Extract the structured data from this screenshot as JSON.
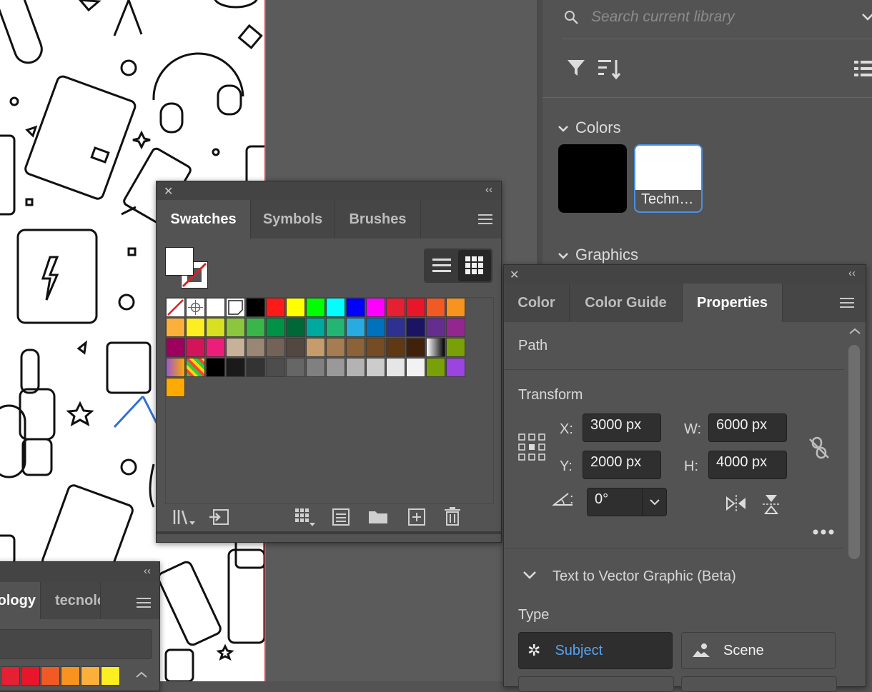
{
  "libraries": {
    "search_placeholder": "Search current library",
    "colors_header": "Colors",
    "graphics_header": "Graphics",
    "color_tiles": [
      {
        "label": "",
        "color": "#000000"
      },
      {
        "label": "Techn…",
        "color": "#ffffff"
      }
    ]
  },
  "swatches_panel": {
    "tabs": [
      "Swatches",
      "Symbols",
      "Brushes"
    ],
    "active_tab": "Swatches",
    "rows": [
      [
        "none",
        "registration",
        "#ffffff",
        "#ffffff",
        "#000000",
        "#ff1a1a",
        "#ffff00",
        "#00ff00",
        "#00ffff",
        "#0000ff",
        "#ff00ff",
        "#e42032",
        "#e8162b",
        "#f15a24",
        "#f7931e"
      ],
      [
        "#fbb03b",
        "#fcee21",
        "#d9e021",
        "#8cc63f",
        "#39b54a",
        "#009245",
        "#006837",
        "#00a99d",
        "#22b573",
        "#29abe2",
        "#0071bc",
        "#2e3192",
        "#1b1464",
        "#662d91",
        "#93278f"
      ],
      [
        "#9e005d",
        "#d4145a",
        "#ed1e79",
        "#c7b299",
        "#998675",
        "#736357",
        "#534741",
        "#c69c6d",
        "#a67c52",
        "#8c6239",
        "#754c24",
        "#603813",
        "#42210b",
        "gradient-bw",
        "#7aa008"
      ],
      [
        "gradient-purple",
        "pattern",
        "#000000",
        "#1a1a1a",
        "#333333",
        "#4d4d4d",
        "#666666",
        "#808080",
        "#999999",
        "#b3b3b3",
        "#cccccc",
        "#e6e6e6",
        "#f2f2f2",
        "#7aa008",
        "#9b44e0"
      ],
      [
        "#ffaa00"
      ]
    ]
  },
  "properties_panel": {
    "tabs": [
      "Color",
      "Color Guide",
      "Properties"
    ],
    "active_tab": "Properties",
    "object_type": "Path",
    "transform_label": "Transform",
    "x_label": "X:",
    "x_value": "3000 px",
    "y_label": "Y:",
    "y_value": "2000 px",
    "w_label": "W:",
    "w_value": "6000 px",
    "h_label": "H:",
    "h_value": "4000 px",
    "angle_label": ":",
    "angle_value": "0°",
    "ttvg_header": "Text to Vector Graphic (Beta)",
    "type_label": "Type",
    "subject_label": "Subject",
    "scene_label": "Scene"
  },
  "bottom_panel": {
    "tabs": [
      "ology",
      "tecnolo"
    ],
    "colors": [
      "#e42032",
      "#e8162b",
      "#f15a24",
      "#f7931e",
      "#fbb03b",
      "#fcee21"
    ]
  }
}
